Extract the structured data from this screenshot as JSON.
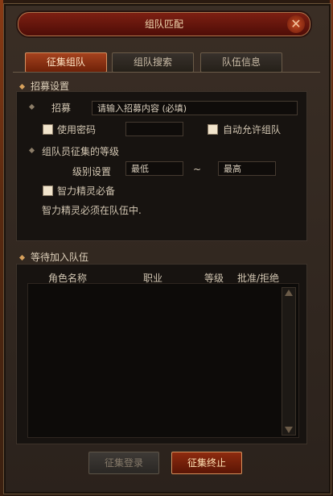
{
  "window": {
    "title": "组队匹配",
    "close_glyph": "✕"
  },
  "tabs": [
    {
      "label": "征集组队",
      "active": true
    },
    {
      "label": "组队搜索",
      "active": false
    },
    {
      "label": "队伍信息",
      "active": false
    }
  ],
  "recruit": {
    "header": "招募设置",
    "recruit_label": "招募",
    "recruit_placeholder": "请输入招募内容 (必填)",
    "password_label": "使用密码",
    "password_value": "",
    "auto_accept_label": "自动允许组队",
    "level_header": "组队员征集的等级",
    "level_label": "级别设置",
    "level_min": "最低",
    "level_separator": "~",
    "level_max": "最高",
    "spirit_label": "智力精灵必备",
    "spirit_note": "智力精灵必须在队伍中."
  },
  "waiting": {
    "header": "等待加入队伍",
    "columns": [
      "角色名称",
      "职业",
      "等级",
      "批准/拒绝"
    ],
    "rows": []
  },
  "buttons": {
    "register": "征集登录",
    "end": "征集终止"
  },
  "colors": {
    "accent": "#a5421e",
    "frame": "#3a2e25",
    "text": "#d8cdbb"
  }
}
